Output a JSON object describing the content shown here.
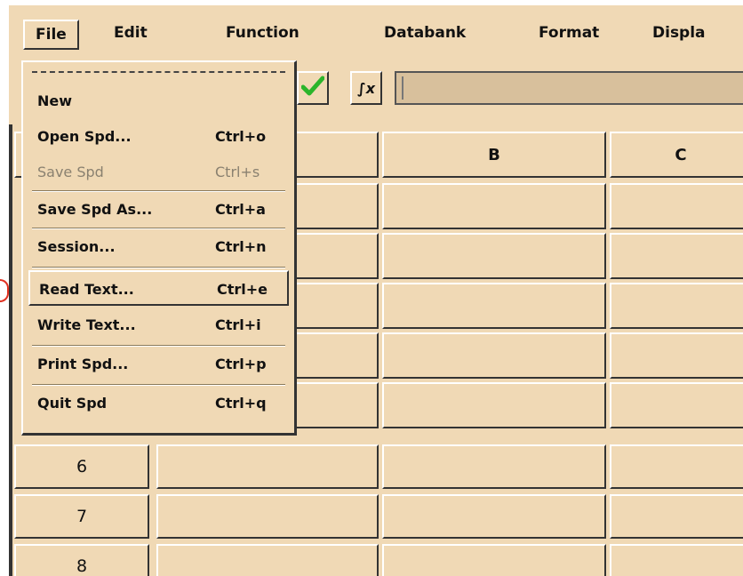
{
  "menubar": {
    "items": [
      {
        "label": "File"
      },
      {
        "label": "Edit"
      },
      {
        "label": "Function"
      },
      {
        "label": "Databank"
      },
      {
        "label": "Format"
      },
      {
        "label": "Displa"
      }
    ]
  },
  "toolbar": {
    "check_icon": "check-icon",
    "fx_label": "∫x",
    "formula_value": ""
  },
  "grid": {
    "columns": [
      "B",
      "C"
    ],
    "rows": [
      "6",
      "7",
      "8"
    ]
  },
  "file_menu": {
    "items": [
      {
        "label": "New",
        "shortcut": ""
      },
      {
        "label": "Open Spd...",
        "shortcut": "Ctrl+o"
      },
      {
        "label": "Save Spd",
        "shortcut": "Ctrl+s"
      },
      {
        "label": "Save Spd As...",
        "shortcut": "Ctrl+a"
      },
      {
        "label": "Session...",
        "shortcut": "Ctrl+n"
      },
      {
        "label": "Read Text...",
        "shortcut": "Ctrl+e"
      },
      {
        "label": "Write Text...",
        "shortcut": "Ctrl+i"
      },
      {
        "label": "Print Spd...",
        "shortcut": "Ctrl+p"
      },
      {
        "label": "Quit Spd",
        "shortcut": "Ctrl+q"
      }
    ]
  }
}
